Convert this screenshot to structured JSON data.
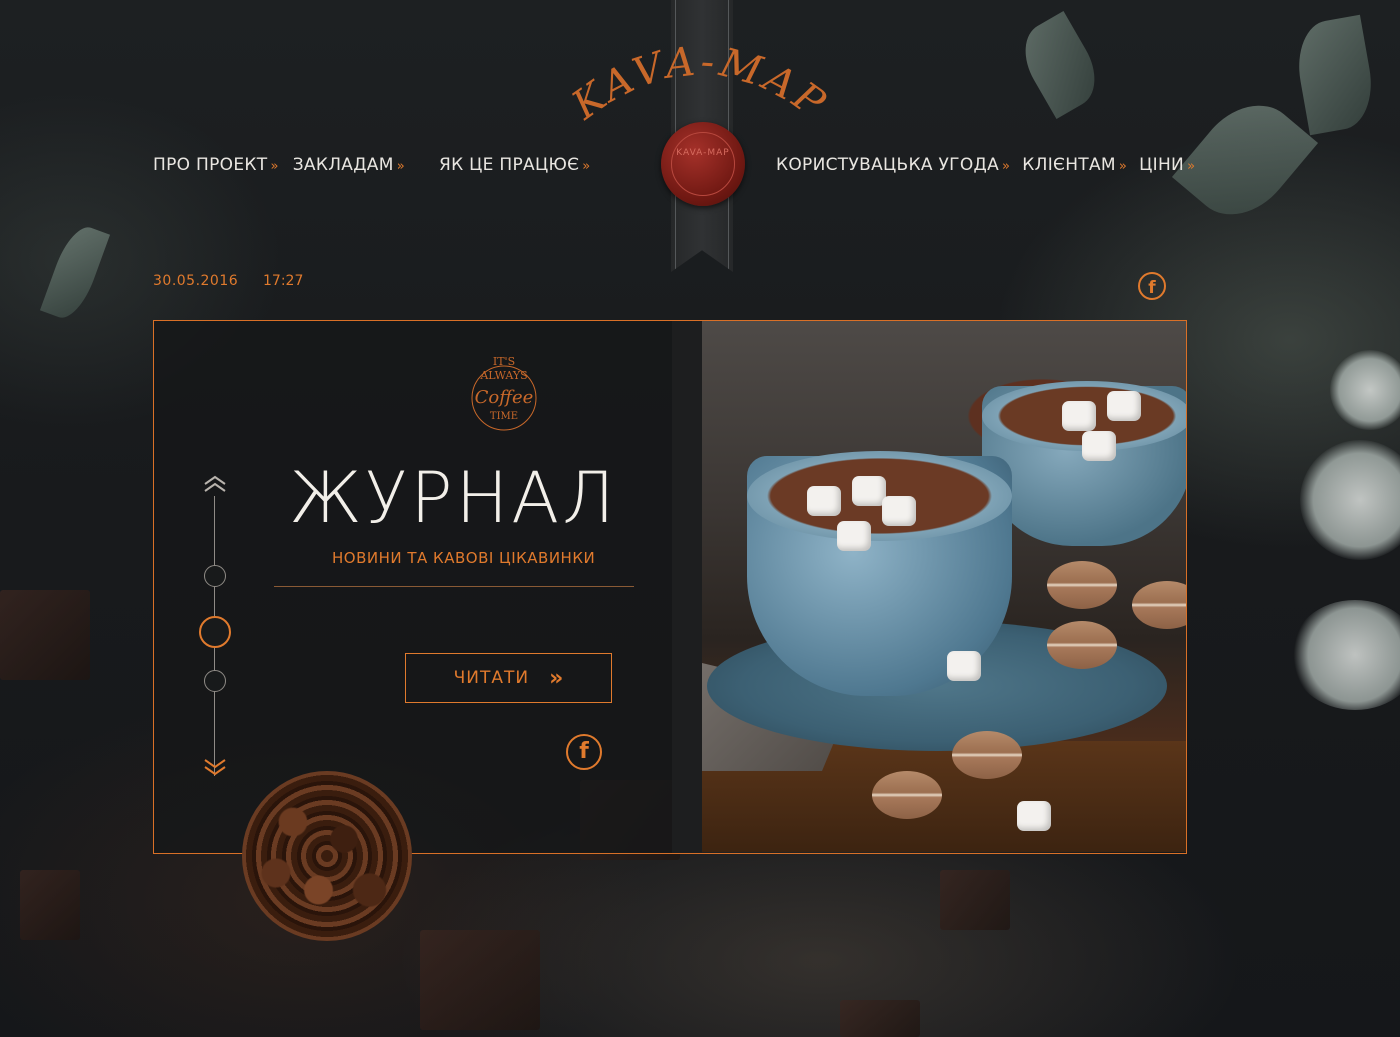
{
  "brand": {
    "name": "KAVA-MAP",
    "seal_text": "KAVA-MAP"
  },
  "nav": {
    "left": [
      {
        "label": "ПРО ПРОЕКТ"
      },
      {
        "label": "ЗАКЛАДАМ"
      },
      {
        "label": "ЯК ЦЕ ПРАЦЮЄ"
      }
    ],
    "right": [
      {
        "label": "КОРИСТУВАЦЬКА УГОДА"
      },
      {
        "label": "КЛІЄНТАМ"
      },
      {
        "label": "ЦІНИ"
      }
    ],
    "chevron": "»"
  },
  "meta": {
    "date": "30.05.2016",
    "time": "17:27"
  },
  "social": {
    "facebook_glyph": "f"
  },
  "hero": {
    "badge": {
      "line1": "IT'S",
      "line2": "ALWAYS",
      "line3": "Coffee",
      "line4": "TIME"
    },
    "title": "ЖУРНАЛ",
    "subtitle": "НОВИНИ ТА КАВОВІ ЦІКАВИНКИ",
    "read_button": "ЧИТАТИ",
    "read_arrow": "»"
  },
  "slider": {
    "up_glyph": "⌃",
    "down_glyph": "⌄",
    "active_index": 1,
    "count": 3
  },
  "colors": {
    "accent": "#e07a2d",
    "background": "#181a1c",
    "text": "#e9e6e1"
  },
  "icons": [
    "facebook-icon",
    "chevron-down-icon",
    "double-chevron-right-icon",
    "up-arrow-icon",
    "down-arrow-icon"
  ]
}
